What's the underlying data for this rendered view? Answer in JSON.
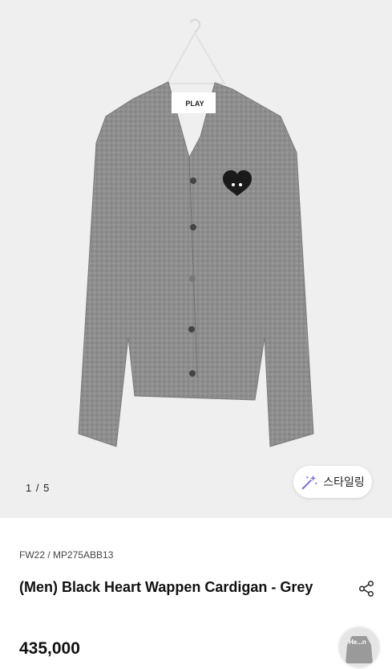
{
  "gallery": {
    "counter": "1 / 5",
    "style_button_label": "스타일링",
    "hanger_tag_text": "PLAY"
  },
  "product": {
    "code": "FW22 / MP275ABB13",
    "title": "(Men) Black Heart Wappen Cardigan - Grey",
    "price": "435,000",
    "thumb_label": "He...n"
  },
  "icons": {
    "share": "share-icon",
    "style": "magic-wand-icon"
  },
  "colors": {
    "gallery_bg": "#efefef",
    "cardigan_grey": "#8c8c8c",
    "text": "#111111"
  }
}
